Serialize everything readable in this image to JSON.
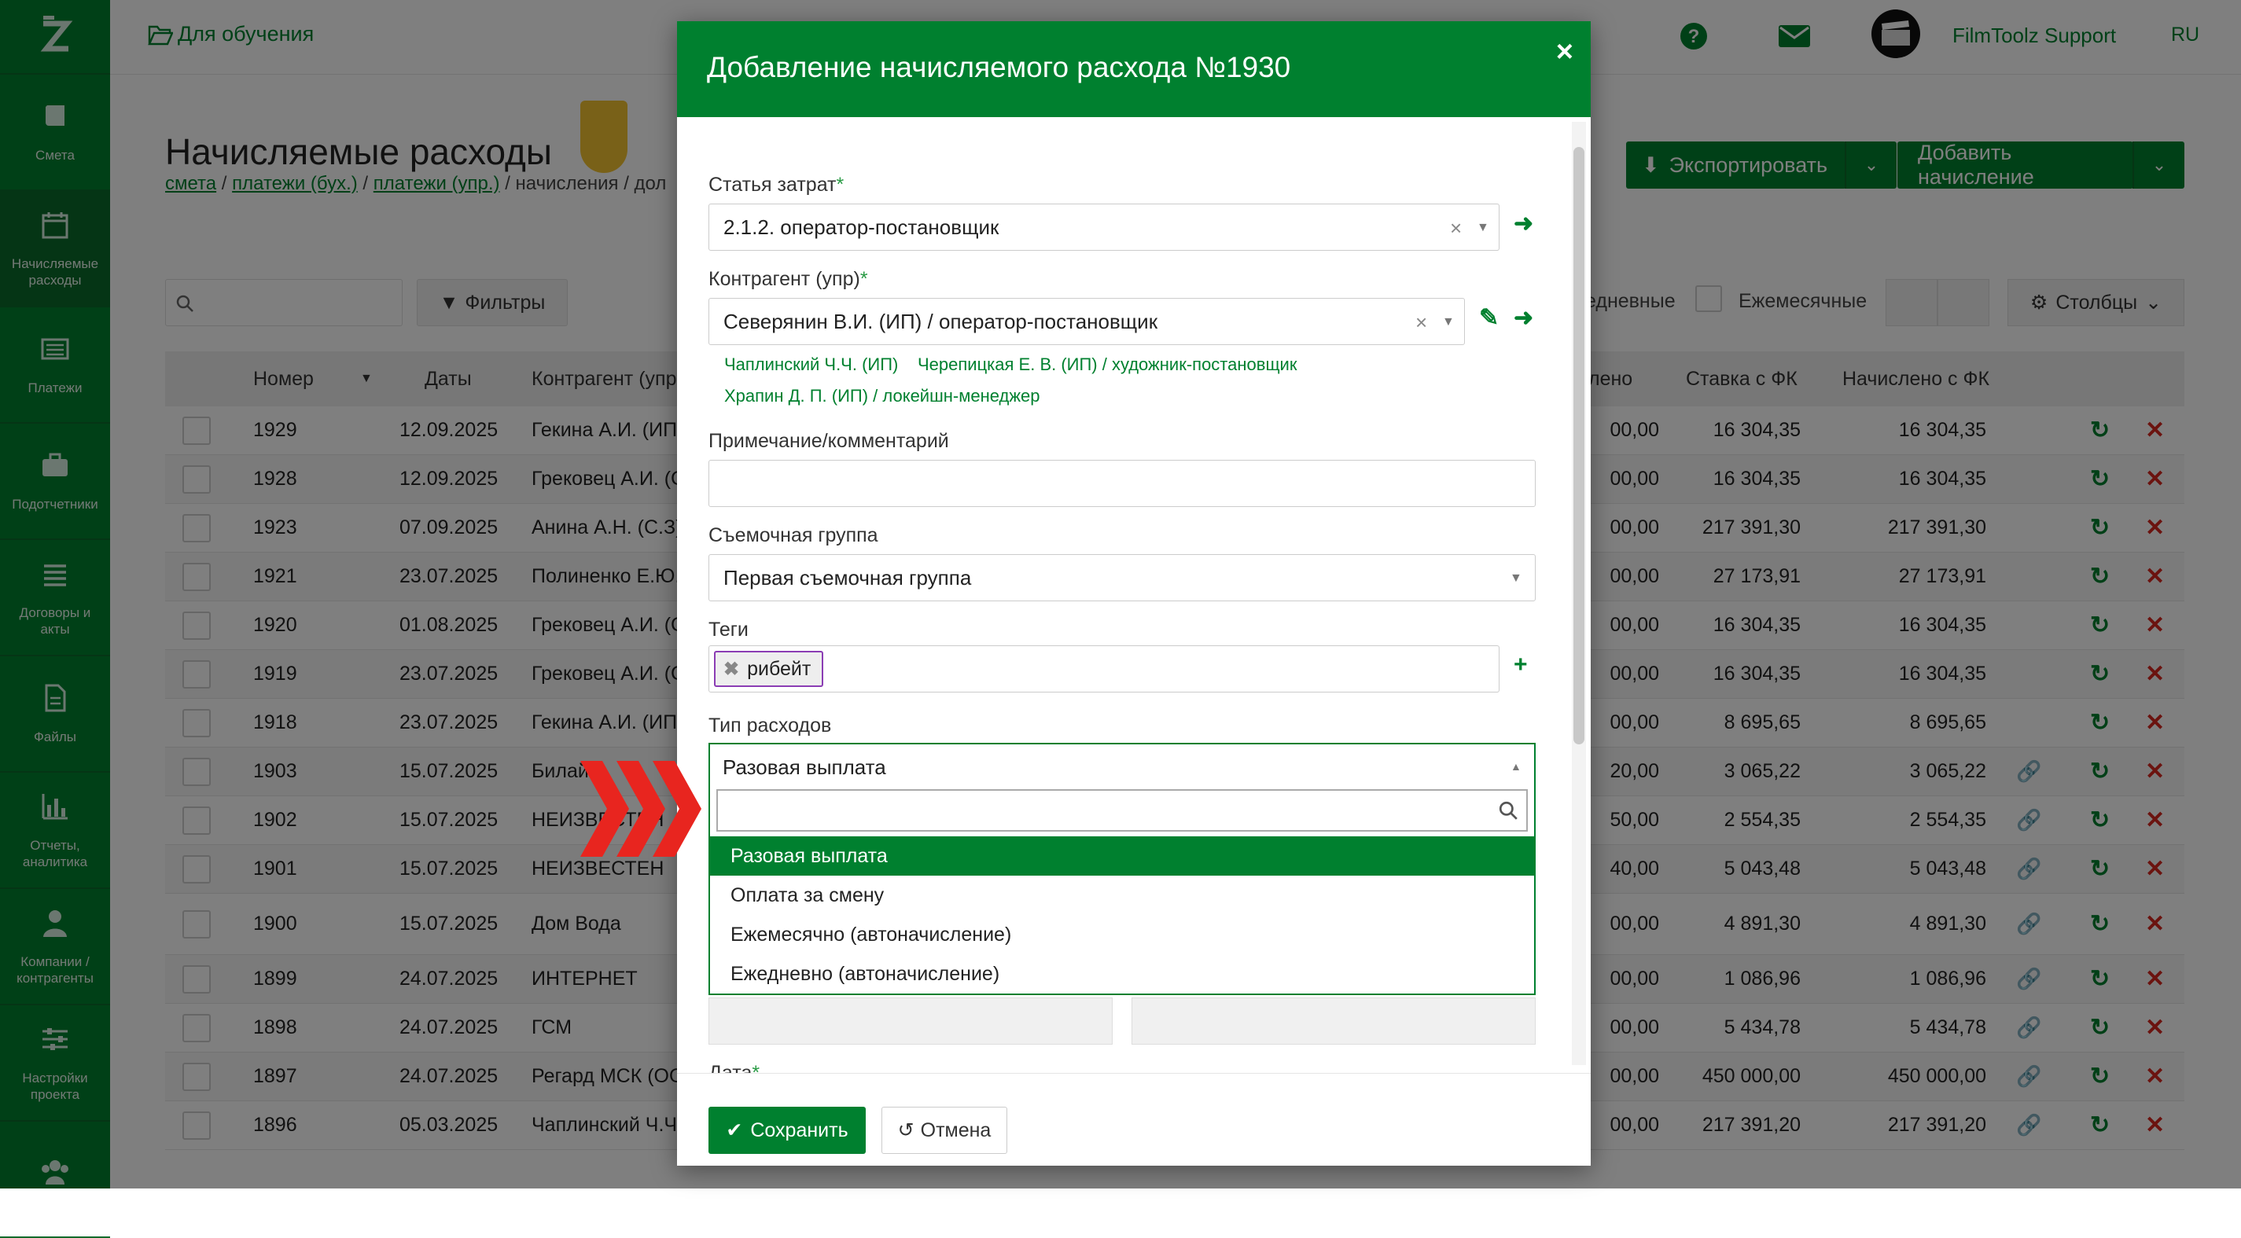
{
  "sidebar": {
    "items": [
      {
        "label": "Смета",
        "icon": "book-icon"
      },
      {
        "label": "Начисляемые расходы",
        "icon": "calendar-icon"
      },
      {
        "label": "Платежи",
        "icon": "list-icon"
      },
      {
        "label": "Подотчетники",
        "icon": "briefcase-icon"
      },
      {
        "label": "Договоры и акты",
        "icon": "list-lines-icon"
      },
      {
        "label": "Файлы",
        "icon": "file-icon"
      },
      {
        "label": "Отчеты, аналитика",
        "icon": "bar-chart-icon"
      },
      {
        "label": "Компании / контрагенты",
        "icon": "user-icon"
      },
      {
        "label": "Настройки проекта",
        "icon": "sliders-icon"
      },
      {
        "label": "",
        "icon": "users-icon"
      }
    ]
  },
  "topbar": {
    "project": "Для обучения",
    "support": "FilmToolz Support",
    "lang": "RU"
  },
  "page": {
    "title": "Начисляемые расходы",
    "breadcrumbs": [
      "смета",
      "платежи (бух.)",
      "платежи (упр.)"
    ],
    "crumb_tail": "начисления / дол",
    "export_btn": "Экспортировать",
    "add_btn": "Добавить начисление",
    "filters_btn": "Фильтры",
    "daily_label": "едневные",
    "monthly_label": "Ежемесячные",
    "columns_btn": "Столбцы"
  },
  "table": {
    "headers": {
      "number": "Номер",
      "dates": "Даты",
      "counterparty": "Контрагент (упр",
      "accrued": "лено",
      "rate_fk": "Ставка с ФК",
      "accrued_fk": "Начислено с ФК"
    },
    "rows": [
      {
        "num": "1929",
        "date": "12.09.2025",
        "cp": "Гекина А.И. (ИП)",
        "acc": "00,00",
        "rate": "16 304,35",
        "total": "16 304,35",
        "link": false
      },
      {
        "num": "1928",
        "date": "12.09.2025",
        "cp": "Грековец А.И. (С",
        "acc": "00,00",
        "rate": "16 304,35",
        "total": "16 304,35",
        "link": false
      },
      {
        "num": "1923",
        "date": "07.09.2025",
        "cp": "Анина А.Н. (С.З)",
        "acc": "00,00",
        "rate": "217 391,30",
        "total": "217 391,30",
        "link": false
      },
      {
        "num": "1921",
        "date": "23.07.2025",
        "cp": "Полиненко Е.Ю.",
        "acc": "00,00",
        "rate": "27 173,91",
        "total": "27 173,91",
        "link": false
      },
      {
        "num": "1920",
        "date": "01.08.2025",
        "cp": "Грековец А.И. (С",
        "acc": "00,00",
        "rate": "16 304,35",
        "total": "16 304,35",
        "link": false
      },
      {
        "num": "1919",
        "date": "23.07.2025",
        "cp": "Грековец А.И. (С",
        "acc": "00,00",
        "rate": "16 304,35",
        "total": "16 304,35",
        "link": false
      },
      {
        "num": "1918",
        "date": "23.07.2025",
        "cp": "Гекина А.И. (ИП)",
        "acc": "00,00",
        "rate": "8 695,65",
        "total": "8 695,65",
        "link": false
      },
      {
        "num": "1903",
        "date": "15.07.2025",
        "cp": "Билай",
        "acc": "20,00",
        "rate": "3 065,22",
        "total": "3 065,22",
        "link": true
      },
      {
        "num": "1902",
        "date": "15.07.2025",
        "cp": "НЕИЗВЕСТЕН",
        "acc": "50,00",
        "rate": "2 554,35",
        "total": "2 554,35",
        "link": true
      },
      {
        "num": "1901",
        "date": "15.07.2025",
        "cp": "НЕИЗВЕСТЕН",
        "acc": "40,00",
        "rate": "5 043,48",
        "total": "5 043,48",
        "link": true
      },
      {
        "num": "1900",
        "date": "15.07.2025",
        "cp": "Дом Вода",
        "acc": "00,00",
        "rate": "4 891,30",
        "total": "4 891,30",
        "link": true
      },
      {
        "num": "1899",
        "date": "24.07.2025",
        "cp": "ИНТЕРНЕТ",
        "acc": "00,00",
        "rate": "1 086,96",
        "total": "1 086,96",
        "link": true
      },
      {
        "num": "1898",
        "date": "24.07.2025",
        "cp": "ГСМ",
        "acc": "00,00",
        "rate": "5 434,78",
        "total": "5 434,78",
        "link": true
      },
      {
        "num": "1897",
        "date": "24.07.2025",
        "cp": "Регард МСК (ОО",
        "acc": "00,00",
        "rate": "450 000,00",
        "total": "450 000,00",
        "link": true
      },
      {
        "num": "1896",
        "date": "05.03.2025",
        "cp": "Чаплинский Ч.Ч",
        "acc": "00,00",
        "rate": "217 391,20",
        "total": "217 391,20",
        "link": true
      }
    ]
  },
  "modal": {
    "title": "Добавление начисляемого расхода №1930",
    "cost_item_label": "Статья затрат",
    "cost_item_value": "2.1.2. оператор-постановщик",
    "counterparty_label": "Контрагент (упр)",
    "counterparty_value": "Северянин В.И. (ИП) / оператор-постановщик",
    "suggestions": [
      "Чаплинский Ч.Ч. (ИП)",
      "Черепицкая Е. В. (ИП) / художник-постановщик",
      "Храпин Д. П. (ИП) / локейшн-менеджер"
    ],
    "note_label": "Примечание/комментарий",
    "crew_label": "Съемочная группа",
    "crew_value": "Первая съемочная группа",
    "tags_label": "Теги",
    "tag_value": "рибейт",
    "type_label": "Тип расходов",
    "type_value": "Разовая выплата",
    "type_options": [
      "Разовая выплата",
      "Оплата за смену",
      "Ежемесячно (автоначисление)",
      "Ежедневно (автоначисление)"
    ],
    "date_label": "Дата",
    "save_btn": "Сохранить",
    "cancel_btn": "Отмена"
  },
  "colors": {
    "brand": "#00802f",
    "danger": "#d7261e",
    "arrow": "#e8251f",
    "tag_border": "#8b3db4"
  }
}
